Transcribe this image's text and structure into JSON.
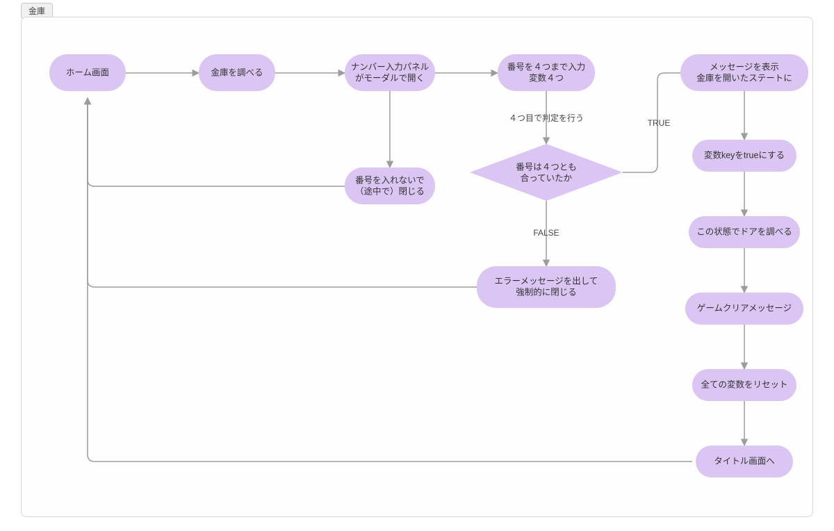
{
  "tab_label": "金庫",
  "nodes": {
    "home": {
      "line1": "ホーム画面"
    },
    "inspect": {
      "line1": "金庫を調べる"
    },
    "modal": {
      "line1": "ナンバー入力パネル",
      "line2": "がモーダルで開く"
    },
    "input4": {
      "line1": "番号を４つまで入力",
      "line2": "変数４つ"
    },
    "close_early": {
      "line1": "番号を入れないで",
      "line2": "（途中で）閉じる"
    },
    "decision": {
      "line1": "番号は４つとも",
      "line2": "合っていたか"
    },
    "error": {
      "line1": "エラーメッセージを出して",
      "line2": "強制的に閉じる"
    },
    "msg_open": {
      "line1": "メッセージを表示",
      "line2": "金庫を開いたステートに"
    },
    "key_true": {
      "line1": "変数keyをtrueにする"
    },
    "check_door": {
      "line1": "この状態でドアを調べる"
    },
    "clear_msg": {
      "line1": "ゲームクリアメッセージ"
    },
    "reset_vars": {
      "line1": "全ての変数をリセット"
    },
    "to_title": {
      "line1": "タイトル画面へ"
    }
  },
  "edge_labels": {
    "judge_at_4": "４つ目で判定を行う",
    "true": "TRUE",
    "false": "FALSE"
  }
}
